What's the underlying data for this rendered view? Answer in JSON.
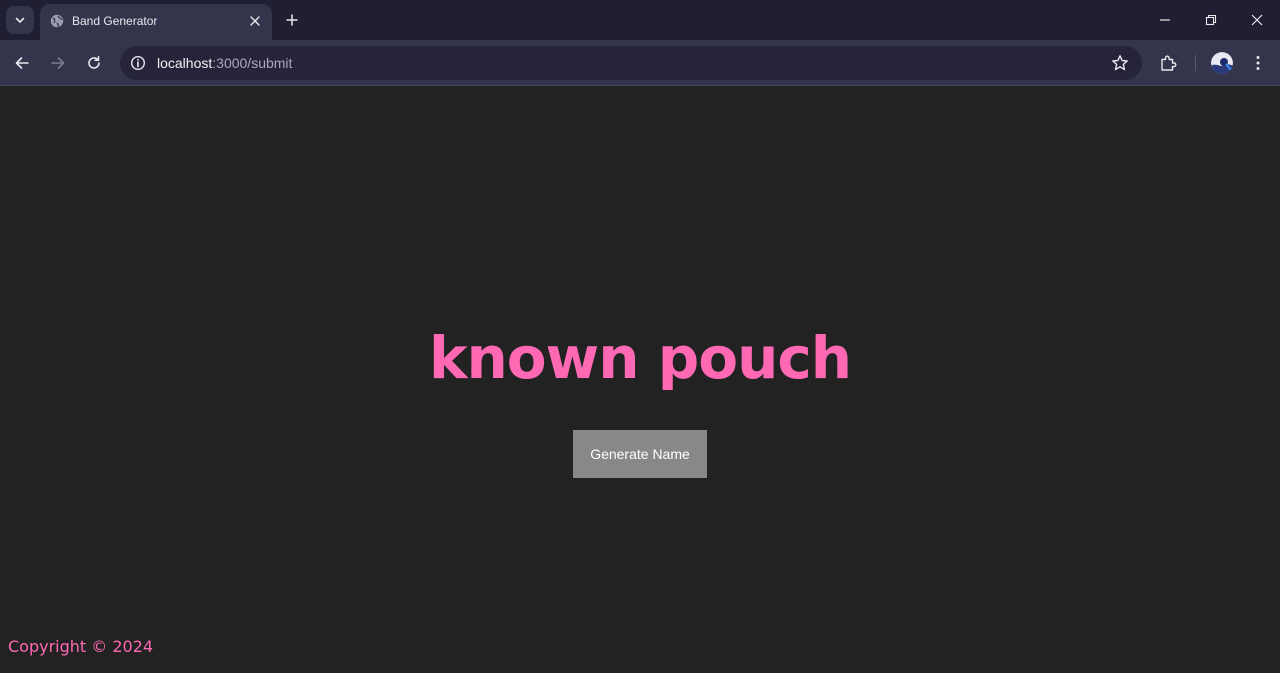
{
  "browser": {
    "tab_title": "Band Generator",
    "url_host": "localhost",
    "url_path": ":3000/submit",
    "icons": [
      "tab-search-icon",
      "globe-icon",
      "close-icon",
      "plus-icon",
      "minimize-icon",
      "restore-icon",
      "window-close-icon",
      "back-icon",
      "forward-icon",
      "reload-icon",
      "info-icon",
      "star-icon",
      "extensions-icon",
      "avatar",
      "menu-icon"
    ]
  },
  "page": {
    "band_name": "known pouch",
    "button_label": "Generate Name",
    "footer": "Copyright © 2024"
  },
  "colors": {
    "accent": "#ff69b4",
    "background": "#222222",
    "button": "#888888"
  }
}
